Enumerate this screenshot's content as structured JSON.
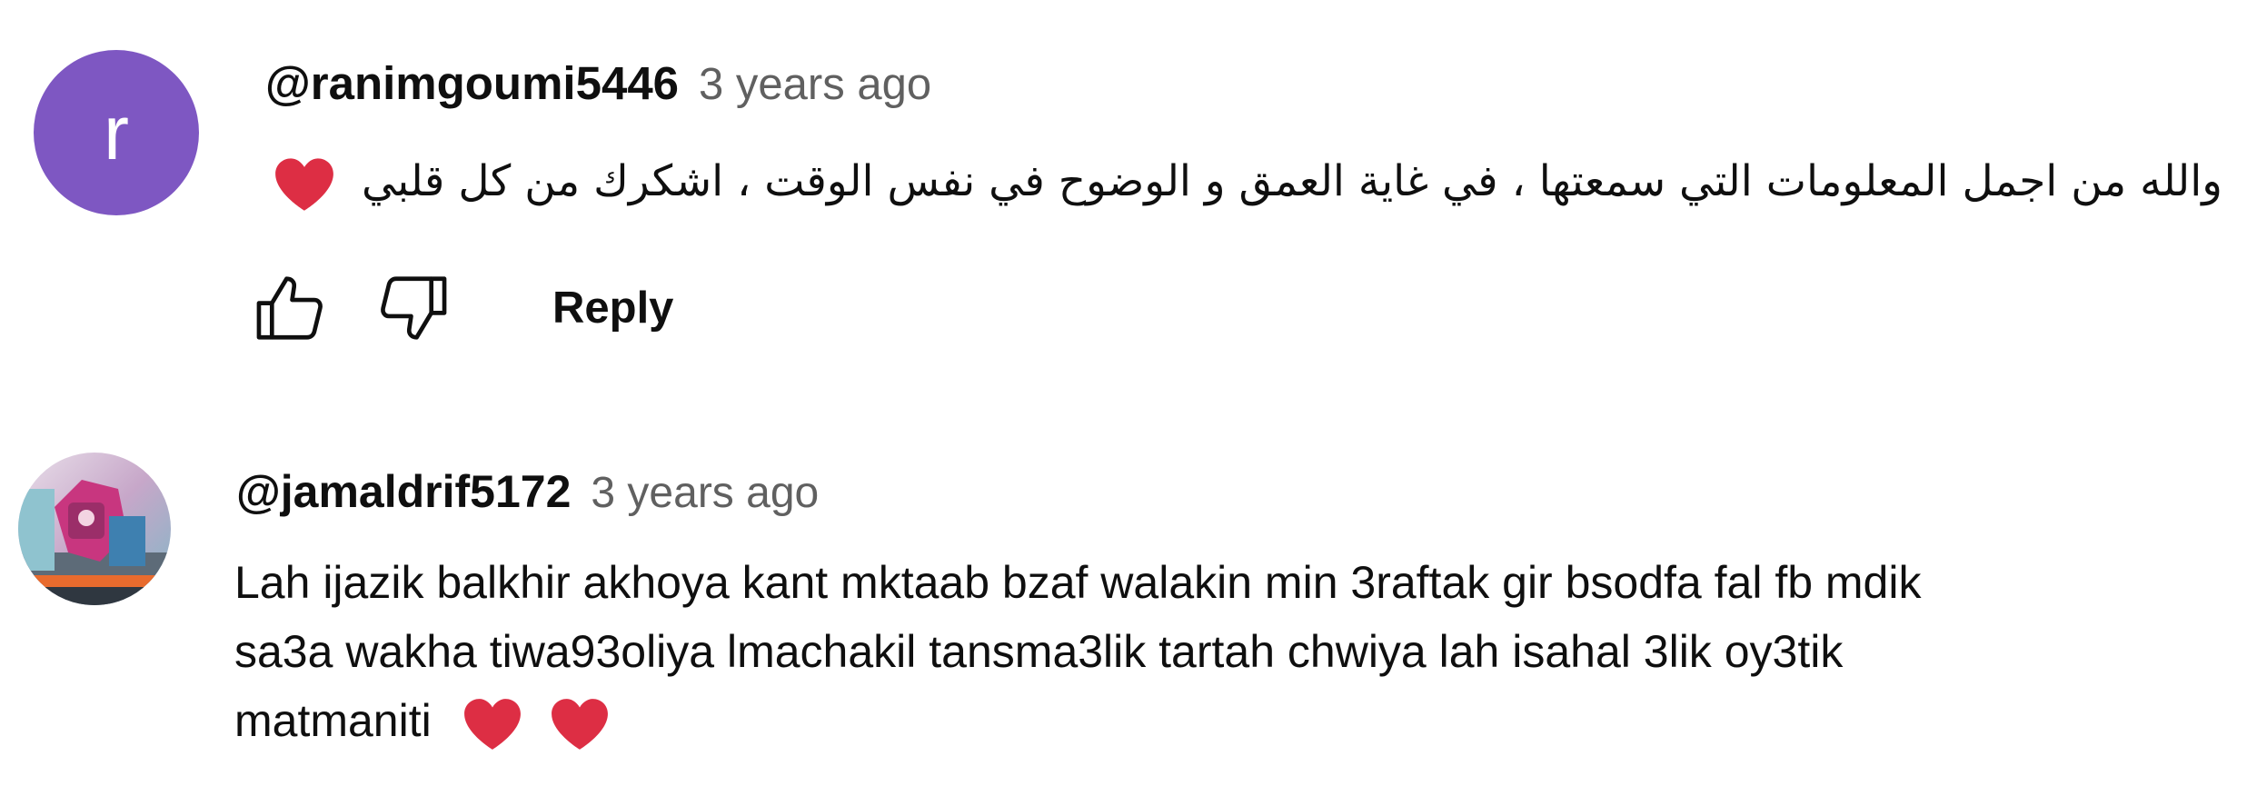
{
  "comments": [
    {
      "avatar_letter": "r",
      "avatar_color": "#7e57c2",
      "author": "@ranimgoumi5446",
      "time": "3 years ago",
      "text": "والله من اجمل المعلومات التي سمعتها ، في غاية العمق و الوضوح في نفس الوقت ، اشكرك من كل قلبي",
      "emoji": "heart-icon",
      "reply_label": "Reply"
    },
    {
      "author": "@jamaldrif5172",
      "time": "3 years ago",
      "text_lines": [
        "Lah ijazik balkhir akhoya kant mktaab bzaf walakin min 3raftak gir bsodfa fal fb mdik",
        "sa3a wakha tiwa93oliya lmachakil tansma3lik tartah chwiya lah isahal 3lik oy3tik",
        "matmaniti"
      ],
      "emojis": [
        "heart-icon",
        "heart-icon"
      ]
    }
  ],
  "colors": {
    "heart": "#dd2e44",
    "secondary_text": "#606060"
  }
}
